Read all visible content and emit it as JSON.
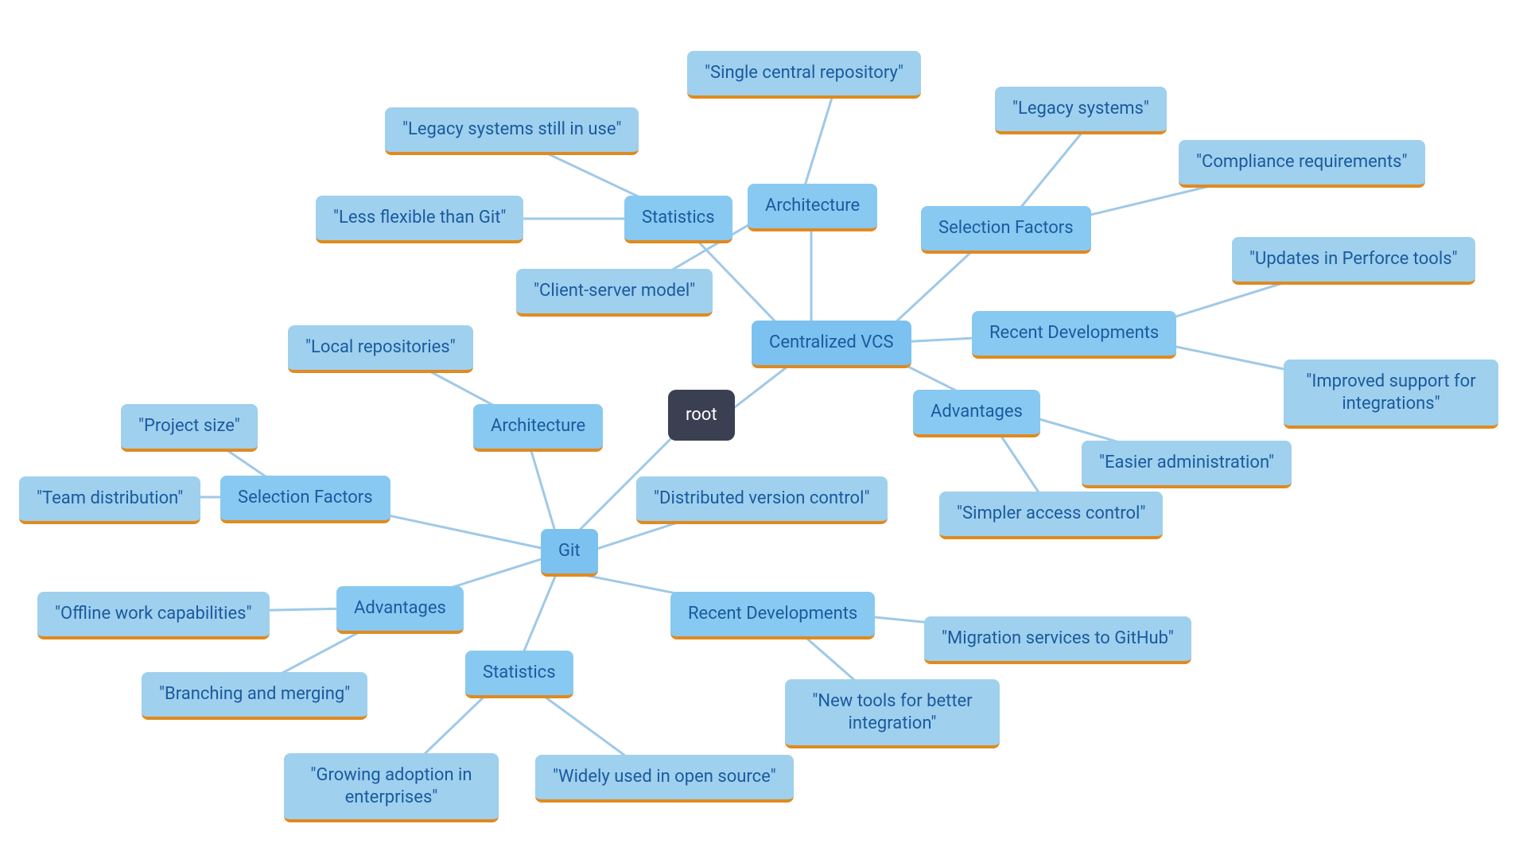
{
  "root": {
    "label": "root"
  },
  "git": {
    "label": "Git",
    "architecture": {
      "label": "Architecture",
      "local_repos": "\"Local repositories\"",
      "distributed": "\"Distributed version control\""
    },
    "advantages": {
      "label": "Advantages",
      "offline": "\"Offline work capabilities\"",
      "branching": "\"Branching and merging\""
    },
    "statistics": {
      "label": "Statistics",
      "growing": "\"Growing adoption in enterprises\"",
      "opensource": "\"Widely used in open source\""
    },
    "recent": {
      "label": "Recent Developments",
      "newtools": "\"New tools for better integration\"",
      "migration": "\"Migration services to GitHub\""
    },
    "selection": {
      "label": "Selection Factors",
      "project_size": "\"Project size\"",
      "team_dist": "\"Team distribution\""
    }
  },
  "cvcs": {
    "label": "Centralized VCS",
    "architecture": {
      "label": "Architecture",
      "single_repo": "\"Single central repository\"",
      "client_server": "\"Client-server model\""
    },
    "statistics": {
      "label": "Statistics",
      "legacy_use": "\"Legacy systems still in use\"",
      "less_flexible": "\"Less flexible than Git\""
    },
    "selection": {
      "label": "Selection Factors",
      "legacy": "\"Legacy systems\"",
      "compliance": "\"Compliance requirements\""
    },
    "recent": {
      "label": "Recent Developments",
      "perforce": "\"Updates in Perforce tools\"",
      "integrations": "\"Improved support for integrations\""
    },
    "advantages": {
      "label": "Advantages",
      "easier_admin": "\"Easier administration\"",
      "simpler_access": "\"Simpler access control\""
    }
  }
}
